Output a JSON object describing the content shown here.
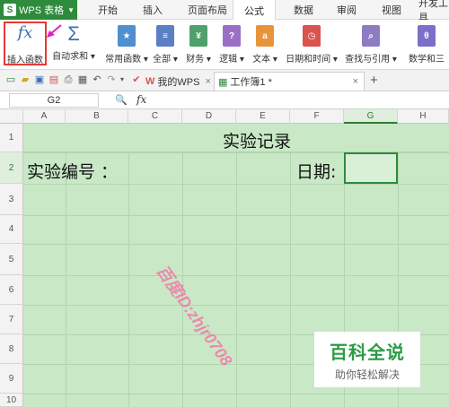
{
  "menubar": {
    "app": "WPS 表格",
    "tabs": [
      "开始",
      "插入",
      "页面布局",
      "公式",
      "数据",
      "审阅",
      "视图",
      "开发工具"
    ],
    "active_tab": "公式"
  },
  "ribbon": {
    "insert_function": "插入函数",
    "autosum": "自动求和",
    "common_functions": "常用函数",
    "all": "全部",
    "finance": "财务",
    "logic": "逻辑",
    "text": "文本",
    "datetime": "日期和时间",
    "lookup": "查找与引用",
    "math": "数学和三"
  },
  "quickbar": {
    "tab_mywps": "我的WPS",
    "tab_workbook": "工作簿1 *",
    "add": "+"
  },
  "formula_bar": {
    "name_box": "G2",
    "fx": "fx"
  },
  "sheet": {
    "columns": [
      "A",
      "B",
      "C",
      "D",
      "E",
      "F",
      "G",
      "H"
    ],
    "rows": [
      "1",
      "2",
      "3",
      "4",
      "5",
      "6",
      "7",
      "8",
      "9",
      "10"
    ],
    "title": "实验记录",
    "label_number": "实验编号 ：",
    "label_date": "日期:"
  },
  "watermark": "百度ID:zhjr0708",
  "brand": {
    "name": "百科全说",
    "slogan": "助你轻松解决"
  },
  "colors": {
    "accent": "#2e8b3c",
    "sheet_bg": "#c9e8c6",
    "highlight": "#e53935"
  }
}
